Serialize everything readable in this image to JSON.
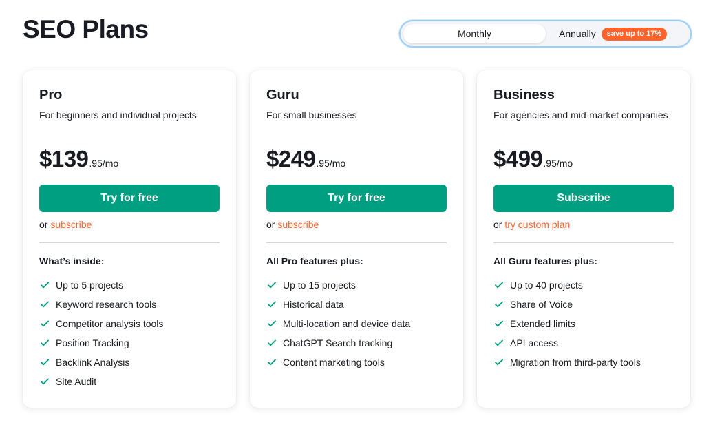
{
  "page": {
    "title": "SEO Plans"
  },
  "billing_toggle": {
    "monthly_label": "Monthly",
    "annually_label": "Annually",
    "save_badge": "save up to 17%",
    "selected": "Monthly"
  },
  "colors": {
    "accent_green": "#009f81",
    "accent_orange": "#ff642d",
    "text": "#181b22"
  },
  "plans": [
    {
      "name": "Pro",
      "description": "For beginners and individual projects",
      "price_main": "$139",
      "price_suffix": ".95/mo",
      "cta_label": "Try for free",
      "alt_prefix": "or ",
      "alt_link": "subscribe",
      "features_heading": "What’s inside:",
      "features": [
        "Up to 5 projects",
        "Keyword research tools",
        "Competitor analysis tools",
        "Position Tracking",
        "Backlink Analysis",
        "Site Audit"
      ]
    },
    {
      "name": "Guru",
      "description": "For small businesses",
      "price_main": "$249",
      "price_suffix": ".95/mo",
      "cta_label": "Try for free",
      "alt_prefix": "or ",
      "alt_link": "subscribe",
      "features_heading": "All Pro features plus:",
      "features": [
        "Up to 15 projects",
        "Historical data",
        "Multi-location and device data",
        "ChatGPT Search tracking",
        "Content marketing tools"
      ]
    },
    {
      "name": "Business",
      "description": "For agencies and mid-market companies",
      "price_main": "$499",
      "price_suffix": ".95/mo",
      "cta_label": "Subscribe",
      "alt_prefix": "or ",
      "alt_link": "try custom plan",
      "features_heading": "All Guru features plus:",
      "features": [
        "Up to 40 projects",
        "Share of Voice",
        "Extended limits",
        "API access",
        "Migration from third-party tools"
      ]
    }
  ]
}
